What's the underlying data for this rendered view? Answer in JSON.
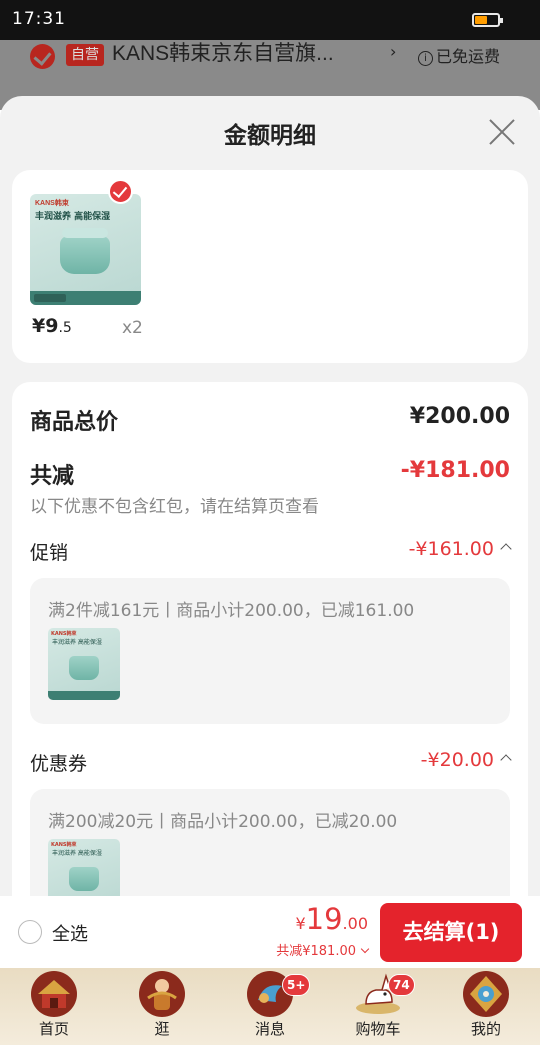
{
  "status_bar": {
    "time": "17:31",
    "battery_level": 0.55,
    "battery_color": "#ff9d00"
  },
  "background_page": {
    "self_run_badge": "自营",
    "shop_name": "KANS韩束京东自营旗...",
    "arrow": "›",
    "free_shipping": "已免运费"
  },
  "sheet": {
    "title": "金额明细",
    "product": {
      "price_int": "¥9",
      "price_dec": ".5",
      "quantity": "x2"
    },
    "goods_total_label": "商品总价",
    "goods_total_value": "¥200.00",
    "reduction_label": "共减",
    "reduction_value": "-¥181.00",
    "reduction_note": "以下优惠不包含红包，请在结算页查看",
    "promotion": {
      "label": "促销",
      "value": "-¥161.00",
      "detail": "满2件减161元丨商品小计200.00，已减161.00"
    },
    "coupon": {
      "label": "优惠券",
      "value": "-¥20.00",
      "detail": "满200减20元丨商品小计200.00，已减20.00"
    },
    "product_image": {
      "brand": "KANS韩束",
      "slogan": "丰润滋养 高能保湿"
    }
  },
  "checkout": {
    "select_all": "全选",
    "total_yen": "¥",
    "total_int": "19",
    "total_dec": ".00",
    "total_discount": "共减¥181.00",
    "pay_button": "去结算(1)"
  },
  "tabbar": {
    "items": [
      {
        "label": "首页",
        "icon": "home-icon",
        "badge": ""
      },
      {
        "label": "逛",
        "icon": "browse-icon",
        "badge": ""
      },
      {
        "label": "消息",
        "icon": "message-icon",
        "badge": "5+"
      },
      {
        "label": "购物车",
        "icon": "cart-icon",
        "badge": "74"
      },
      {
        "label": "我的",
        "icon": "profile-icon",
        "badge": ""
      }
    ]
  },
  "colors": {
    "accent_red": "#e4393c",
    "button_red": "#e4232c",
    "tabbar_bg": "#efe4cf"
  }
}
